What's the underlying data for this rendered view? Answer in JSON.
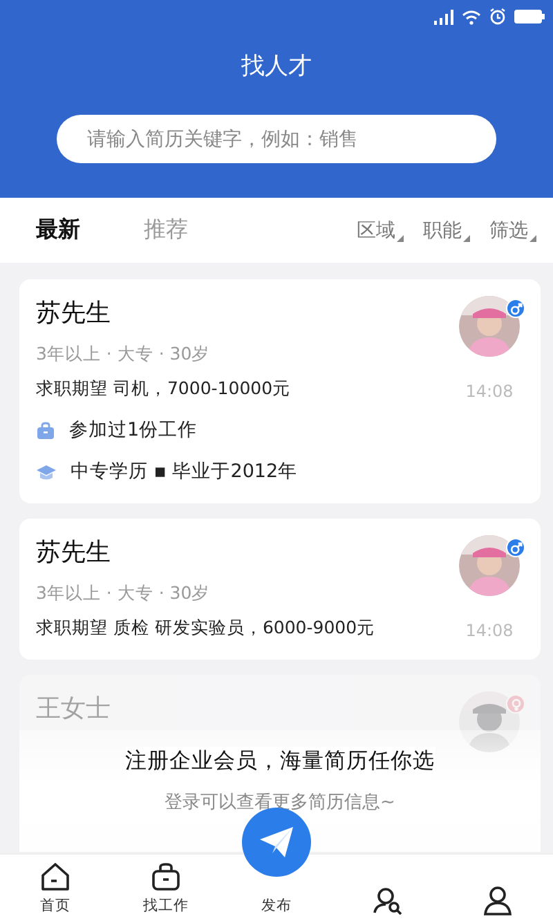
{
  "header": {
    "title": "找人才"
  },
  "search": {
    "placeholder": "请输入简历关键字，例如：销售"
  },
  "tabs": [
    {
      "label": "最新",
      "selected": true
    },
    {
      "label": "推荐",
      "selected": false
    }
  ],
  "filters": [
    {
      "label": "区域"
    },
    {
      "label": "职能"
    },
    {
      "label": "筛选"
    }
  ],
  "cards": [
    {
      "name": "苏先生",
      "male": true,
      "meta": "3年以上 · 大专 · 30岁",
      "expect": "求职期望 司机，7000-10000元",
      "time": "14:08",
      "faded": false,
      "details": [
        {
          "kind": "work",
          "text": "参加过1份工作"
        },
        {
          "kind": "education",
          "text": "中专学历 ▪ 毕业于2012年"
        }
      ]
    },
    {
      "name": "苏先生",
      "male": true,
      "meta": "3年以上 · 大专 · 30岁",
      "expect": "求职期望 质检 研发实验员，6000-9000元",
      "time": "14:08",
      "faded": false
    },
    {
      "name": "王女士",
      "male": false,
      "faded": true
    }
  ],
  "prompt": {
    "title": "注册企业会员，海量简历任你选",
    "subtitle": "登录可以查看更多简历信息~"
  },
  "nav": [
    {
      "kind": "home",
      "label": "首页"
    },
    {
      "kind": "jobs",
      "label": "找工作"
    },
    {
      "kind": "publish",
      "label": "发布"
    },
    {
      "kind": "talent"
    },
    {
      "kind": "me"
    }
  ]
}
